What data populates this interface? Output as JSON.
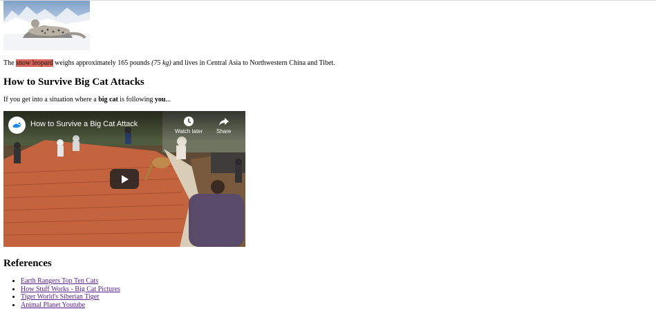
{
  "intro": {
    "prefix": "The ",
    "highlight": "snow leopard",
    "middle": " weighs approximately 165 pounds ",
    "metric": "(75 kg)",
    "suffix": " and lives in Central Asia to Northwestern China and Tibet."
  },
  "section1": {
    "heading": "How to Survive Big Cat Attacks",
    "lead_prefix": "If you get into a situation where a ",
    "lead_bold1": "big cat",
    "lead_middle": " is following ",
    "lead_bold2": "you",
    "lead_suffix": "..."
  },
  "video": {
    "title": "How to Survive a Big Cat Attack",
    "watch_later_label": "Watch later",
    "share_label": "Share",
    "icons": [
      "channel-logo-icon",
      "clock-icon",
      "share-arrow-icon",
      "play-icon"
    ],
    "play_button_color": "#212121"
  },
  "references": {
    "heading": "References",
    "links": [
      "Earth Rangers Top Ten Cats",
      "How Stuff Works - Big Cat Pictures",
      "Tiger World's Siberian Tiger",
      "Animal Planet Youtube"
    ]
  },
  "colors": {
    "highlight": "#d96459",
    "visited_link": "#551a8b"
  }
}
